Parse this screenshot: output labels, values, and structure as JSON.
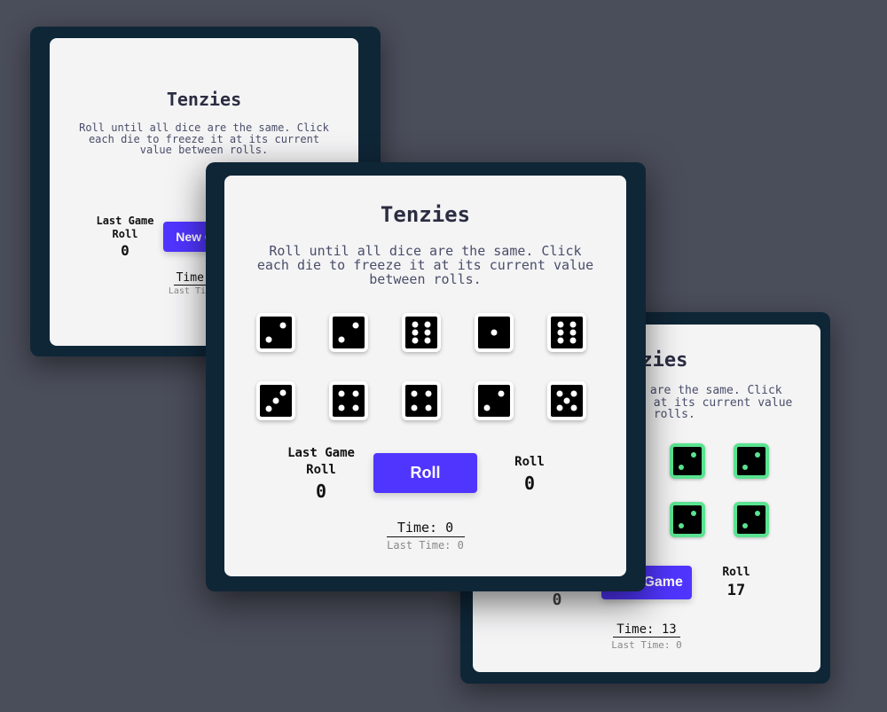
{
  "left_card": {
    "title": "Tenzies",
    "description": "Roll until all dice are the same. Click each die to freeze it at its current value between rolls.",
    "last_game_label_1": "Last Game",
    "last_game_label_2": "Roll",
    "last_game_value": "0",
    "button_label": "New Game",
    "time_label": "Time: 0",
    "last_time_label": "Last Time: 0"
  },
  "center_card": {
    "title": "Tenzies",
    "description": "Roll until all dice are the same. Click each die to freeze it at its current value between rolls.",
    "dice": [
      2,
      2,
      6,
      1,
      6,
      3,
      4,
      4,
      2,
      5
    ],
    "last_game_label_1": "Last Game",
    "last_game_label_2": "Roll",
    "last_game_value": "0",
    "button_label": "Roll",
    "roll_label": "Roll",
    "roll_value": "0",
    "time_label": "Time: 0",
    "last_time_label": "Last Time: 0"
  },
  "right_card": {
    "title": "Tenzies",
    "description": "Roll until all dice are the same. Click each die to freeze it at its current value between rolls.",
    "dice": [
      2,
      2,
      2,
      2,
      2,
      2,
      2,
      2,
      2,
      2
    ],
    "held_color": "#59e391",
    "last_game_value": "0",
    "button_label": "New Game",
    "roll_label": "Roll",
    "roll_value": "17",
    "time_label": "Time: 13",
    "last_time_label": "Last Time: 0"
  },
  "colors": {
    "background": "#4a4d5a",
    "card_frame": "#0f2637",
    "card_inner": "#f4f4f5",
    "button": "#5035ff",
    "title": "#2b2d42"
  }
}
